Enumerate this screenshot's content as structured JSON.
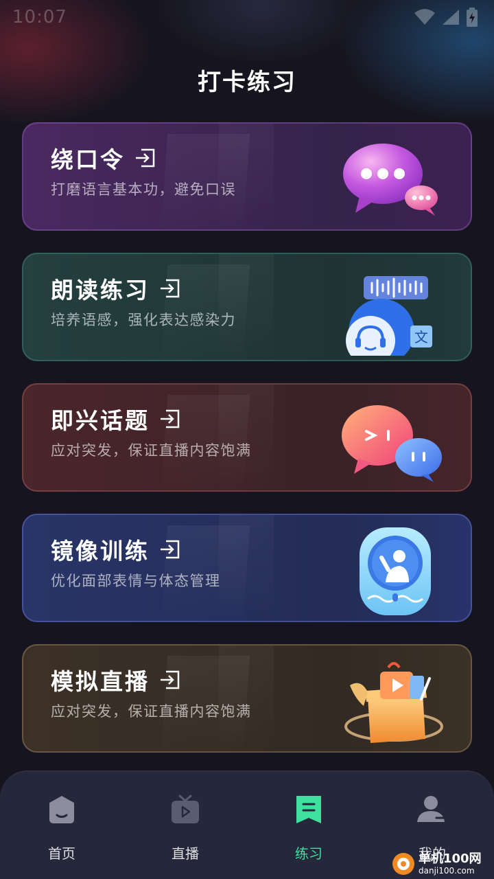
{
  "status_bar": {
    "time": "10:07"
  },
  "page": {
    "title": "打卡练习"
  },
  "cards": [
    {
      "title": "绕口令",
      "subtitle": "打磨语言基本功，避免口误"
    },
    {
      "title": "朗读练习",
      "subtitle": "培养语感，强化表达感染力"
    },
    {
      "title": "即兴话题",
      "subtitle": "应对突发，保证直播内容饱满"
    },
    {
      "title": "镜像训练",
      "subtitle": "优化面部表情与体态管理"
    },
    {
      "title": "模拟直播",
      "subtitle": "应对突发，保证直播内容饱满"
    }
  ],
  "tabbar": {
    "items": [
      {
        "label": "首页",
        "icon": "home-icon"
      },
      {
        "label": "直播",
        "icon": "live-tv-icon"
      },
      {
        "label": "练习",
        "icon": "practice-bookmark-icon"
      },
      {
        "label": "我的",
        "icon": "profile-icon"
      }
    ],
    "active_index": 2,
    "active_color": "#3ee0a0"
  },
  "watermark": {
    "main": "单机100网",
    "sub": "danji100.com"
  },
  "icons": {
    "enter": "enter-arrow-icon"
  }
}
